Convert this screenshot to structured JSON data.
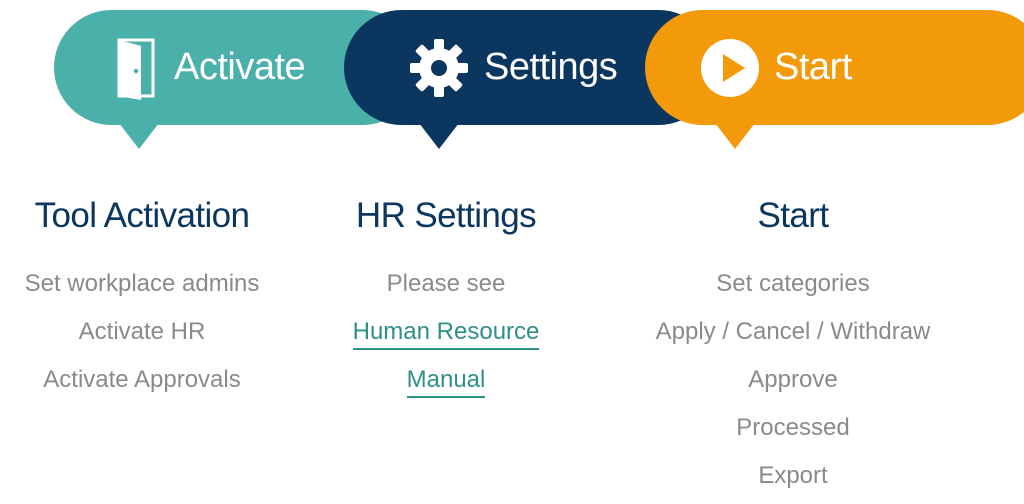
{
  "steps": [
    {
      "label": "Activate",
      "icon": "door-icon",
      "color": "#4ab0a9"
    },
    {
      "label": "Settings",
      "icon": "gear-icon",
      "color": "#0b3660"
    },
    {
      "label": "Start",
      "icon": "play-icon",
      "color": "#f39a0b"
    }
  ],
  "columns": [
    {
      "title": "Tool Activation",
      "items": [
        "Set workplace admins",
        "Activate HR",
        "Activate Approvals"
      ]
    },
    {
      "title": "HR Settings",
      "intro": "Please see",
      "links": [
        "Human Resource ",
        "Manual"
      ]
    },
    {
      "title": "Start",
      "items": [
        "Set categories",
        "Apply / Cancel / Withdraw",
        "Approve",
        "Processed",
        "Export"
      ]
    }
  ],
  "colors": {
    "title": "#0b3660",
    "text": "#8a8a8a",
    "link": "#2f8f89"
  }
}
